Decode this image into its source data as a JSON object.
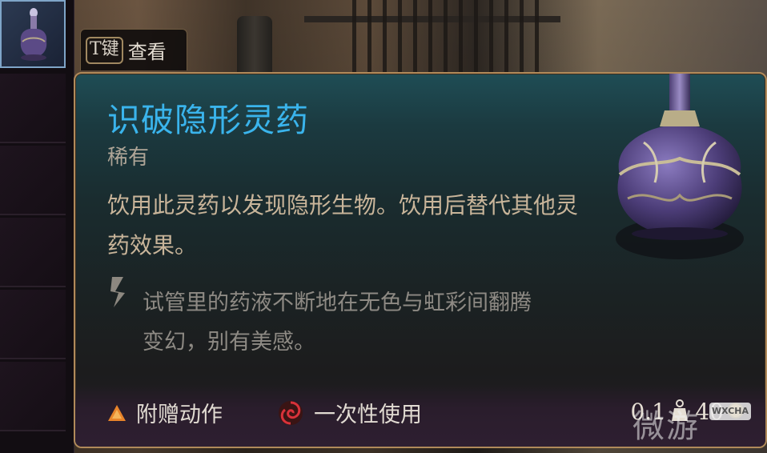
{
  "key_prompt": {
    "key": "T键",
    "action": "查看"
  },
  "item": {
    "name": "识破隐形灵药",
    "rarity": "稀有",
    "description": "饮用此灵药以发现隐形生物。饮用后替代其他灵药效果。",
    "lore": "试管里的药液不断地在无色与虹彩间翻腾变幻，别有美感。",
    "tags": [
      {
        "label": "附赠动作",
        "icon": "bonus-action-triangle-icon"
      },
      {
        "label": "一次性使用",
        "icon": "consumable-swirl-icon"
      }
    ],
    "weight": "0.1",
    "price": "40"
  },
  "watermark": {
    "text": "微游",
    "badge": "WXCHA"
  },
  "colors": {
    "name": "#3ab4ec",
    "rarity": "#aea597",
    "description": "#c9b59a",
    "lore": "#8e8a84",
    "border": "#b08a5a",
    "inventory_selected": "#7fa5c8"
  }
}
